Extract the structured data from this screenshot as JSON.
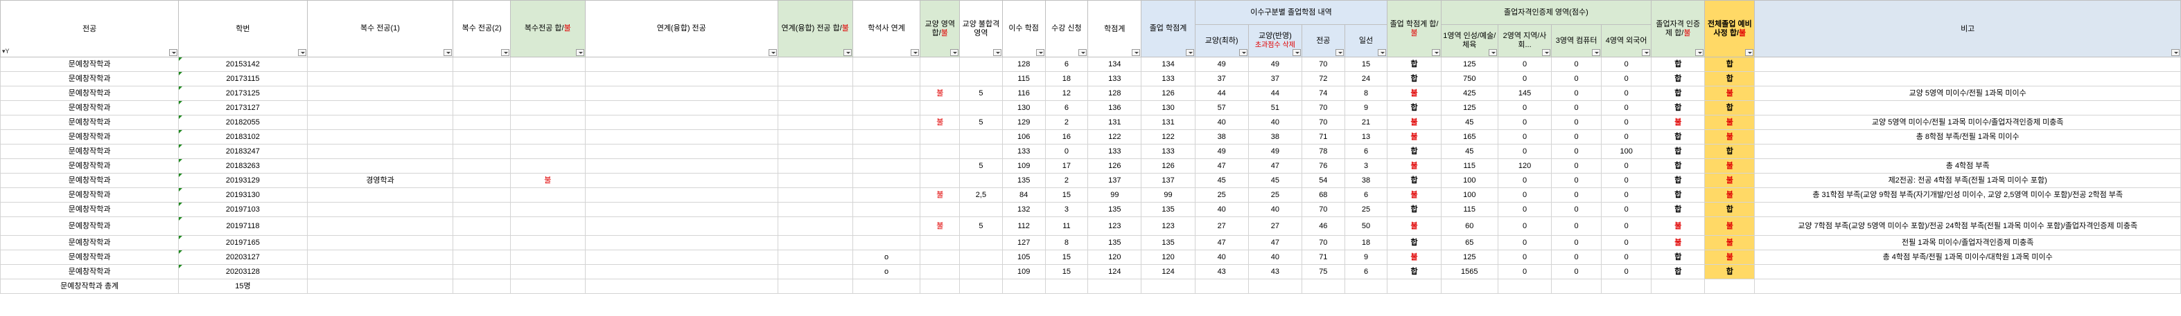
{
  "headers": {
    "major": "전공",
    "student_id": "학번",
    "double_major1": "복수\n전공(1)",
    "double_major2": "복수\n전공(2)",
    "double_major_pass": "복수전공\n합/",
    "double_major_pass_fail": "불",
    "linked_major": "연계(융합)\n전공",
    "linked_major_pass": "연계(융합)\n전공\n합/",
    "linked_major_pass_fail": "불",
    "bachelor_master": "학석사\n연계",
    "liberal_area_pass": "교양\n영역\n합/",
    "liberal_area_pass_fail": "불",
    "liberal_fail_area": "교양\n불합격\n영역",
    "completed_credits": "이수\n학점",
    "enrolled_credits": "수강\n신청",
    "credit_total": "학점계",
    "grad_credit_total": "졸업\n학점계",
    "group_credit_detail": "이수구분별 졸업학점 내역",
    "liberal_req": "교양(최하)",
    "liberal_excess": "교양(반영)",
    "liberal_excess_note": "초과점수 삭제",
    "major_col": "전공",
    "general_col": "일선",
    "grad_credit_pass": "졸업\n학점계\n합/",
    "grad_credit_pass_fail": "불",
    "cert_group": "졸업자격인증제 영역(점수)",
    "cert_area1": "1영역\n인성/예술/\n체육",
    "cert_area2": "2영역\n지역/사회...",
    "cert_area3": "3영역\n컴퓨터",
    "cert_area4": "4영역\n외국어",
    "cert_pass": "졸업자격\n인증제\n합/",
    "cert_pass_fail": "불",
    "overall_pass": "전체졸업\n예비사정\n합/",
    "overall_pass_fail": "불",
    "remarks": "비고",
    "filter_glyph": "▾Y"
  },
  "rows": [
    {
      "major": "문예창작학과",
      "id": "20153142",
      "dm1": "",
      "dm2": "",
      "dmp": "",
      "lm": "",
      "lmp": "",
      "bm": "",
      "lap": "",
      "lfa": "",
      "cc": "128",
      "ec": "6",
      "ct": "134",
      "gct": "134",
      "lr": "49",
      "le": "49",
      "mj": "70",
      "gn": "15",
      "gcp": "합",
      "c1": "125",
      "c2": "0",
      "c3": "0",
      "c4": "0",
      "cp": "합",
      "op": "합",
      "rm": ""
    },
    {
      "major": "문예창작학과",
      "id": "20173115",
      "dm1": "",
      "dm2": "",
      "dmp": "",
      "lm": "",
      "lmp": "",
      "bm": "",
      "lap": "",
      "lfa": "",
      "cc": "115",
      "ec": "18",
      "ct": "133",
      "gct": "133",
      "lr": "37",
      "le": "37",
      "mj": "72",
      "gn": "24",
      "gcp": "합",
      "c1": "750",
      "c2": "0",
      "c3": "0",
      "c4": "0",
      "cp": "합",
      "op": "합",
      "rm": ""
    },
    {
      "major": "문예창작학과",
      "id": "20173125",
      "dm1": "",
      "dm2": "",
      "dmp": "",
      "lm": "",
      "lmp": "",
      "bm": "",
      "lap": "불",
      "lfa": "5",
      "cc": "116",
      "ec": "12",
      "ct": "128",
      "gct": "126",
      "lr": "44",
      "le": "44",
      "mj": "74",
      "gn": "8",
      "gcp": "불",
      "c1": "425",
      "c2": "145",
      "c3": "0",
      "c4": "0",
      "cp": "합",
      "op": "불",
      "rm": "교양 5영역 미이수/전필 1과목 미이수"
    },
    {
      "major": "문예창작학과",
      "id": "20173127",
      "dm1": "",
      "dm2": "",
      "dmp": "",
      "lm": "",
      "lmp": "",
      "bm": "",
      "lap": "",
      "lfa": "",
      "cc": "130",
      "ec": "6",
      "ct": "136",
      "gct": "130",
      "lr": "57",
      "le": "51",
      "mj": "70",
      "gn": "9",
      "gcp": "합",
      "c1": "125",
      "c2": "0",
      "c3": "0",
      "c4": "0",
      "cp": "합",
      "op": "합",
      "rm": ""
    },
    {
      "major": "문예창작학과",
      "id": "20182055",
      "dm1": "",
      "dm2": "",
      "dmp": "",
      "lm": "",
      "lmp": "",
      "bm": "",
      "lap": "불",
      "lfa": "5",
      "cc": "129",
      "ec": "2",
      "ct": "131",
      "gct": "131",
      "lr": "40",
      "le": "40",
      "mj": "70",
      "gn": "21",
      "gcp": "불",
      "c1": "45",
      "c2": "0",
      "c3": "0",
      "c4": "0",
      "cp": "불",
      "op": "불",
      "rm": "교양 5영역 미이수/전필 1과목 미이수/졸업자격인증제 미충족"
    },
    {
      "major": "문예창작학과",
      "id": "20183102",
      "dm1": "",
      "dm2": "",
      "dmp": "",
      "lm": "",
      "lmp": "",
      "bm": "",
      "lap": "",
      "lfa": "",
      "cc": "106",
      "ec": "16",
      "ct": "122",
      "gct": "122",
      "lr": "38",
      "le": "38",
      "mj": "71",
      "gn": "13",
      "gcp": "불",
      "c1": "165",
      "c2": "0",
      "c3": "0",
      "c4": "0",
      "cp": "합",
      "op": "불",
      "rm": "총 8학점 부족/전필 1과목 미이수"
    },
    {
      "major": "문예창작학과",
      "id": "20183247",
      "dm1": "",
      "dm2": "",
      "dmp": "",
      "lm": "",
      "lmp": "",
      "bm": "",
      "lap": "",
      "lfa": "",
      "cc": "133",
      "ec": "0",
      "ct": "133",
      "gct": "133",
      "lr": "49",
      "le": "49",
      "mj": "78",
      "gn": "6",
      "gcp": "합",
      "c1": "45",
      "c2": "0",
      "c3": "0",
      "c4": "100",
      "cp": "합",
      "op": "합",
      "rm": ""
    },
    {
      "major": "문예창작학과",
      "id": "20183263",
      "dm1": "",
      "dm2": "",
      "dmp": "",
      "lm": "",
      "lmp": "",
      "bm": "",
      "lap": "",
      "lfa": "5",
      "cc": "109",
      "ec": "17",
      "ct": "126",
      "gct": "126",
      "lr": "47",
      "le": "47",
      "mj": "76",
      "gn": "3",
      "gcp": "불",
      "c1": "115",
      "c2": "120",
      "c3": "0",
      "c4": "0",
      "cp": "합",
      "op": "불",
      "rm": "총 4학점 부족"
    },
    {
      "major": "문예창작학과",
      "id": "20193129",
      "dm1": "경영학과",
      "dm2": "",
      "dmp": "불",
      "lm": "",
      "lmp": "",
      "bm": "",
      "lap": "",
      "lfa": "",
      "cc": "135",
      "ec": "2",
      "ct": "137",
      "gct": "137",
      "lr": "45",
      "le": "45",
      "mj": "54",
      "gn": "38",
      "gcp": "합",
      "c1": "100",
      "c2": "0",
      "c3": "0",
      "c4": "0",
      "cp": "합",
      "op": "불",
      "rm": "제2전공: 전공 4학점 부족(전필 1과목 미이수 포함)"
    },
    {
      "major": "문예창작학과",
      "id": "20193130",
      "dm1": "",
      "dm2": "",
      "dmp": "",
      "lm": "",
      "lmp": "",
      "bm": "",
      "lap": "불",
      "lfa": "2,5",
      "cc": "84",
      "ec": "15",
      "ct": "99",
      "gct": "99",
      "lr": "25",
      "le": "25",
      "mj": "68",
      "gn": "6",
      "gcp": "불",
      "c1": "100",
      "c2": "0",
      "c3": "0",
      "c4": "0",
      "cp": "합",
      "op": "불",
      "rm": "총 31학점 부족(교양 9학점 부족(자기개발/인성 미이수, 교양 2,5영역 미이수 포함)/전공 2학점 부족"
    },
    {
      "major": "문예창작학과",
      "id": "20197103",
      "dm1": "",
      "dm2": "",
      "dmp": "",
      "lm": "",
      "lmp": "",
      "bm": "",
      "lap": "",
      "lfa": "",
      "cc": "132",
      "ec": "3",
      "ct": "135",
      "gct": "135",
      "lr": "40",
      "le": "40",
      "mj": "70",
      "gn": "25",
      "gcp": "합",
      "c1": "115",
      "c2": "0",
      "c3": "0",
      "c4": "0",
      "cp": "합",
      "op": "합",
      "rm": ""
    },
    {
      "major": "문예창작학과",
      "id": "20197118",
      "dm1": "",
      "dm2": "",
      "dmp": "",
      "lm": "",
      "lmp": "",
      "bm": "",
      "lap": "불",
      "lfa": "5",
      "cc": "112",
      "ec": "11",
      "ct": "123",
      "gct": "123",
      "lr": "27",
      "le": "27",
      "mj": "46",
      "gn": "50",
      "gcp": "불",
      "c1": "60",
      "c2": "0",
      "c3": "0",
      "c4": "0",
      "cp": "불",
      "op": "불",
      "rm": "교양 7학점 부족(교양 5영역 미이수 포함)/전공 24학점 부족(전필 1과목 미이수 포함)/졸업자격인증제 미충족",
      "tall": true
    },
    {
      "major": "문예창작학과",
      "id": "20197165",
      "dm1": "",
      "dm2": "",
      "dmp": "",
      "lm": "",
      "lmp": "",
      "bm": "",
      "lap": "",
      "lfa": "",
      "cc": "127",
      "ec": "8",
      "ct": "135",
      "gct": "135",
      "lr": "47",
      "le": "47",
      "mj": "70",
      "gn": "18",
      "gcp": "합",
      "c1": "65",
      "c2": "0",
      "c3": "0",
      "c4": "0",
      "cp": "불",
      "op": "불",
      "rm": "전필 1과목 미이수/졸업자격인증제 미충족"
    },
    {
      "major": "문예창작학과",
      "id": "20203127",
      "dm1": "",
      "dm2": "",
      "dmp": "",
      "lm": "",
      "lmp": "",
      "bm": "o",
      "lap": "",
      "lfa": "",
      "cc": "105",
      "ec": "15",
      "ct": "120",
      "gct": "120",
      "lr": "40",
      "le": "40",
      "mj": "71",
      "gn": "9",
      "gcp": "불",
      "c1": "125",
      "c2": "0",
      "c3": "0",
      "c4": "0",
      "cp": "합",
      "op": "불",
      "rm": "총 4학점 부족/전필 1과목 미이수/대학원 1과목 미이수"
    },
    {
      "major": "문예창작학과",
      "id": "20203128",
      "dm1": "",
      "dm2": "",
      "dmp": "",
      "lm": "",
      "lmp": "",
      "bm": "o",
      "lap": "",
      "lfa": "",
      "cc": "109",
      "ec": "15",
      "ct": "124",
      "gct": "124",
      "lr": "43",
      "le": "43",
      "mj": "75",
      "gn": "6",
      "gcp": "합",
      "c1": "1565",
      "c2": "0",
      "c3": "0",
      "c4": "0",
      "cp": "합",
      "op": "합",
      "rm": ""
    }
  ],
  "total": {
    "label": "문예창작학과 총계",
    "count": "15명"
  },
  "colors": {
    "pass_green": "#d9ead3",
    "info_blue": "#dbe7f5",
    "overall_yellow": "#ffd966",
    "total_blue": "#b4c6e7",
    "fail_red": "#e00000"
  }
}
